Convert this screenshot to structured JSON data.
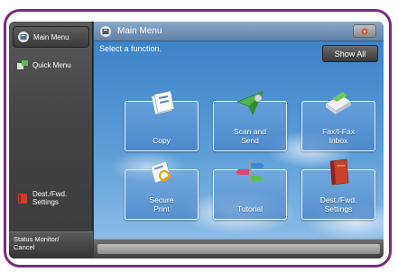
{
  "left_panel": {
    "main_menu": "Main Menu",
    "quick_menu": "Quick Menu",
    "dest_fwd": "Dest./Fwd.\nSettings",
    "status_monitor": "Status Monitor/\nCancel"
  },
  "header": {
    "title": "Main Menu"
  },
  "main": {
    "prompt": "Select a function.",
    "show_all": "Show All",
    "tiles": [
      {
        "label": "Copy",
        "icon": "copy-icon"
      },
      {
        "label": "Scan and\nSend",
        "icon": "scan-send-icon"
      },
      {
        "label": "Fax/I-Fax\nInbox",
        "icon": "fax-inbox-icon"
      },
      {
        "label": "Secure\nPrint",
        "icon": "secure-print-icon"
      },
      {
        "label": "Tutorial",
        "icon": "tutorial-icon"
      },
      {
        "label": "Dest./Fwd.\nSettings",
        "icon": "dest-fwd-icon"
      }
    ]
  },
  "colors": {
    "frame": "#7a2a82",
    "header": "#6a8db2",
    "sky": "#4a8fd0"
  }
}
